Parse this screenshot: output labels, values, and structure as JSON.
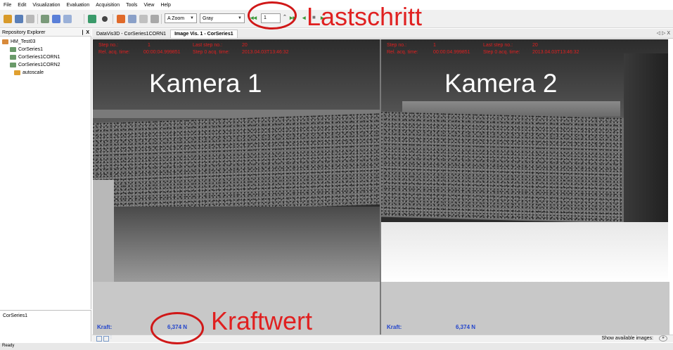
{
  "menubar": [
    "File",
    "Edit",
    "Visualization",
    "Evaluation",
    "Acquisition",
    "Tools",
    "View",
    "Help"
  ],
  "toolbar": {
    "zoom": "A Zoom",
    "colormap": "Gray",
    "step_value": "1"
  },
  "repository": {
    "title": "Repository Explorer",
    "pin": "❘ X",
    "root": "HM_Test03",
    "items": [
      "CorSeries1",
      "CorSeries1CORN1",
      "CorSeries1CORN2",
      "autoscale"
    ],
    "bottom_label": "CorSeries1"
  },
  "tabs": [
    "DataVis3D - CorSeries1CORN1",
    "Image Vis. 1 - CorSeries1"
  ],
  "tab_controls": "◁ ▷ X",
  "cameras": [
    {
      "label": "Kamera 1",
      "step_lbl": "Step no.:",
      "step_val": "1",
      "last_step_lbl": "Last step no.:",
      "last_step_val": "20",
      "rel_time_lbl": "Rel. acq. time:",
      "rel_time_val": "00:00:04.999851",
      "step0_lbl": "Step 0 acq. time:",
      "step0_val": "2013.04.03T13:46:32",
      "kraft_label": "Kraft:",
      "kraft_value": "6,374 N"
    },
    {
      "label": "Kamera 2",
      "step_lbl": "Step no.:",
      "step_val": "1",
      "last_step_lbl": "Last step no.:",
      "last_step_val": "20",
      "rel_time_lbl": "Rel. acq. time:",
      "rel_time_val": "00:00:04.999851",
      "step0_lbl": "Step 0 acq. time:",
      "step0_val": "2013.04.03T13:46:32",
      "kraft_label": "Kraft:",
      "kraft_value": "6,374 N"
    }
  ],
  "annotations": {
    "step": "Lastschritt",
    "force": "Kraftwert"
  },
  "bottom": {
    "show_images": "Show available images:"
  },
  "status": "Ready"
}
